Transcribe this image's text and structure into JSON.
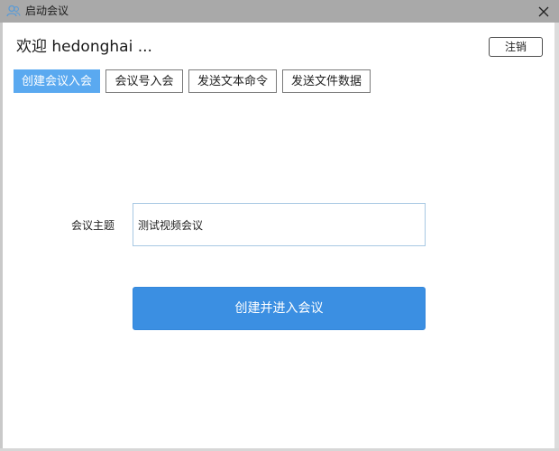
{
  "window": {
    "title": "启动会议",
    "app_icon": "people-icon",
    "close_icon": "close-icon",
    "titlebar_color": "#a9a9a9"
  },
  "header": {
    "welcome_text": "欢迎 hedonghai ...",
    "logout_label": "注销"
  },
  "tabs": [
    {
      "label": "创建会议入会",
      "active": true
    },
    {
      "label": "会议号入会",
      "active": false
    },
    {
      "label": "发送文本命令",
      "active": false
    },
    {
      "label": "发送文件数据",
      "active": false
    }
  ],
  "form": {
    "topic_label": "会议主题",
    "topic_value": "测试视频会议",
    "submit_label": "创建并进入会议"
  },
  "colors": {
    "accent": "#3b8fe2",
    "active_tab": "#5aa9f0"
  }
}
